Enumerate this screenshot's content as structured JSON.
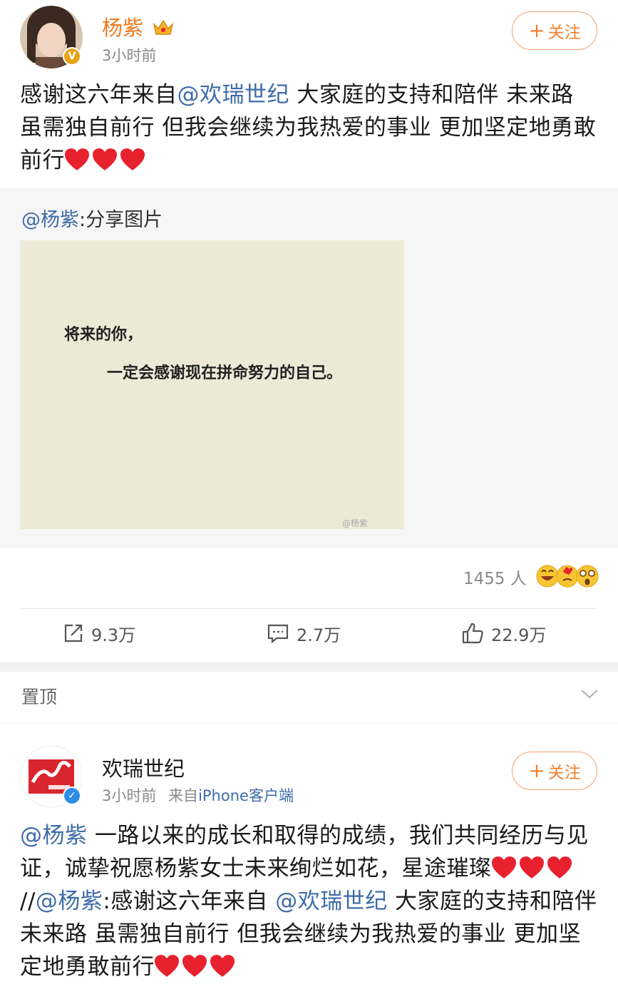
{
  "post1": {
    "author": "杨紫",
    "time": "3小时前",
    "follow_label": "关注",
    "text_part1": "感谢这六年来自",
    "mention1": "@欢瑞世纪",
    "text_part2": " 大家庭的支持和陪伴 未来路 虽需独自前行 但我会继续为我热爱的事业 更加坚定地勇敢前行",
    "repost": {
      "head_mention": "@杨紫",
      "head_text": ":分享图片",
      "image_line1": "将来的你，",
      "image_line2": "一定会感谢现在拼命努力的自己。",
      "watermark": "@杨紫"
    },
    "reaction_count": "1455 人",
    "actions": {
      "repost": "9.3万",
      "comment": "2.7万",
      "like": "22.9万"
    }
  },
  "pinned": {
    "label": "置顶"
  },
  "post2": {
    "author": "欢瑞世纪",
    "time": "3小时前",
    "source_prefix": "来自",
    "source": "iPhone客户端",
    "follow_label": "关注",
    "mention1": "@杨紫",
    "text_part1": " 一路以来的成长和取得的成绩，我们共同经历与见证，诚挚祝愿杨紫女士未来绚烂如花，星途璀璨",
    "separator": "//",
    "mention2": "@杨紫",
    "text_part2": ":感谢这六年来自 ",
    "mention3": "@欢瑞世纪",
    "text_part3": " 大家庭的支持和陪伴 未来路 虽需独自前行 但我会继续为我热爱的事业 更加坚定地勇敢前行"
  },
  "colors": {
    "mention": "#3d6ca8",
    "follow": "#f08030",
    "heart": "#e8212e"
  }
}
